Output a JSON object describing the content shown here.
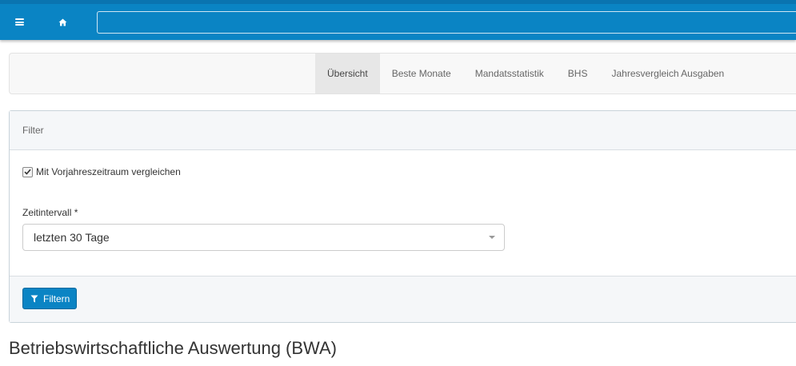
{
  "topbar": {
    "menu_icon": "hamburger-menu-icon",
    "home_icon": "home-icon",
    "search_value": "",
    "color": "#0a84c4"
  },
  "tabs": [
    {
      "label": "Übersicht",
      "active": true
    },
    {
      "label": "Beste Monate",
      "active": false
    },
    {
      "label": "Mandatsstatistik",
      "active": false
    },
    {
      "label": "BHS",
      "active": false
    },
    {
      "label": "Jahresvergleich Ausgaben",
      "active": false
    }
  ],
  "filter": {
    "heading": "Filter",
    "compare_checkbox": {
      "label": "Mit Vorjahreszeitraum vergleichen",
      "checked": true
    },
    "interval": {
      "label": "Zeitintervall *",
      "value": "letzten 30 Tage"
    },
    "submit_label": "Filtern",
    "submit_icon": "filter-icon"
  },
  "page": {
    "title": "Betriebswirtschaftliche Auswertung (BWA)"
  }
}
